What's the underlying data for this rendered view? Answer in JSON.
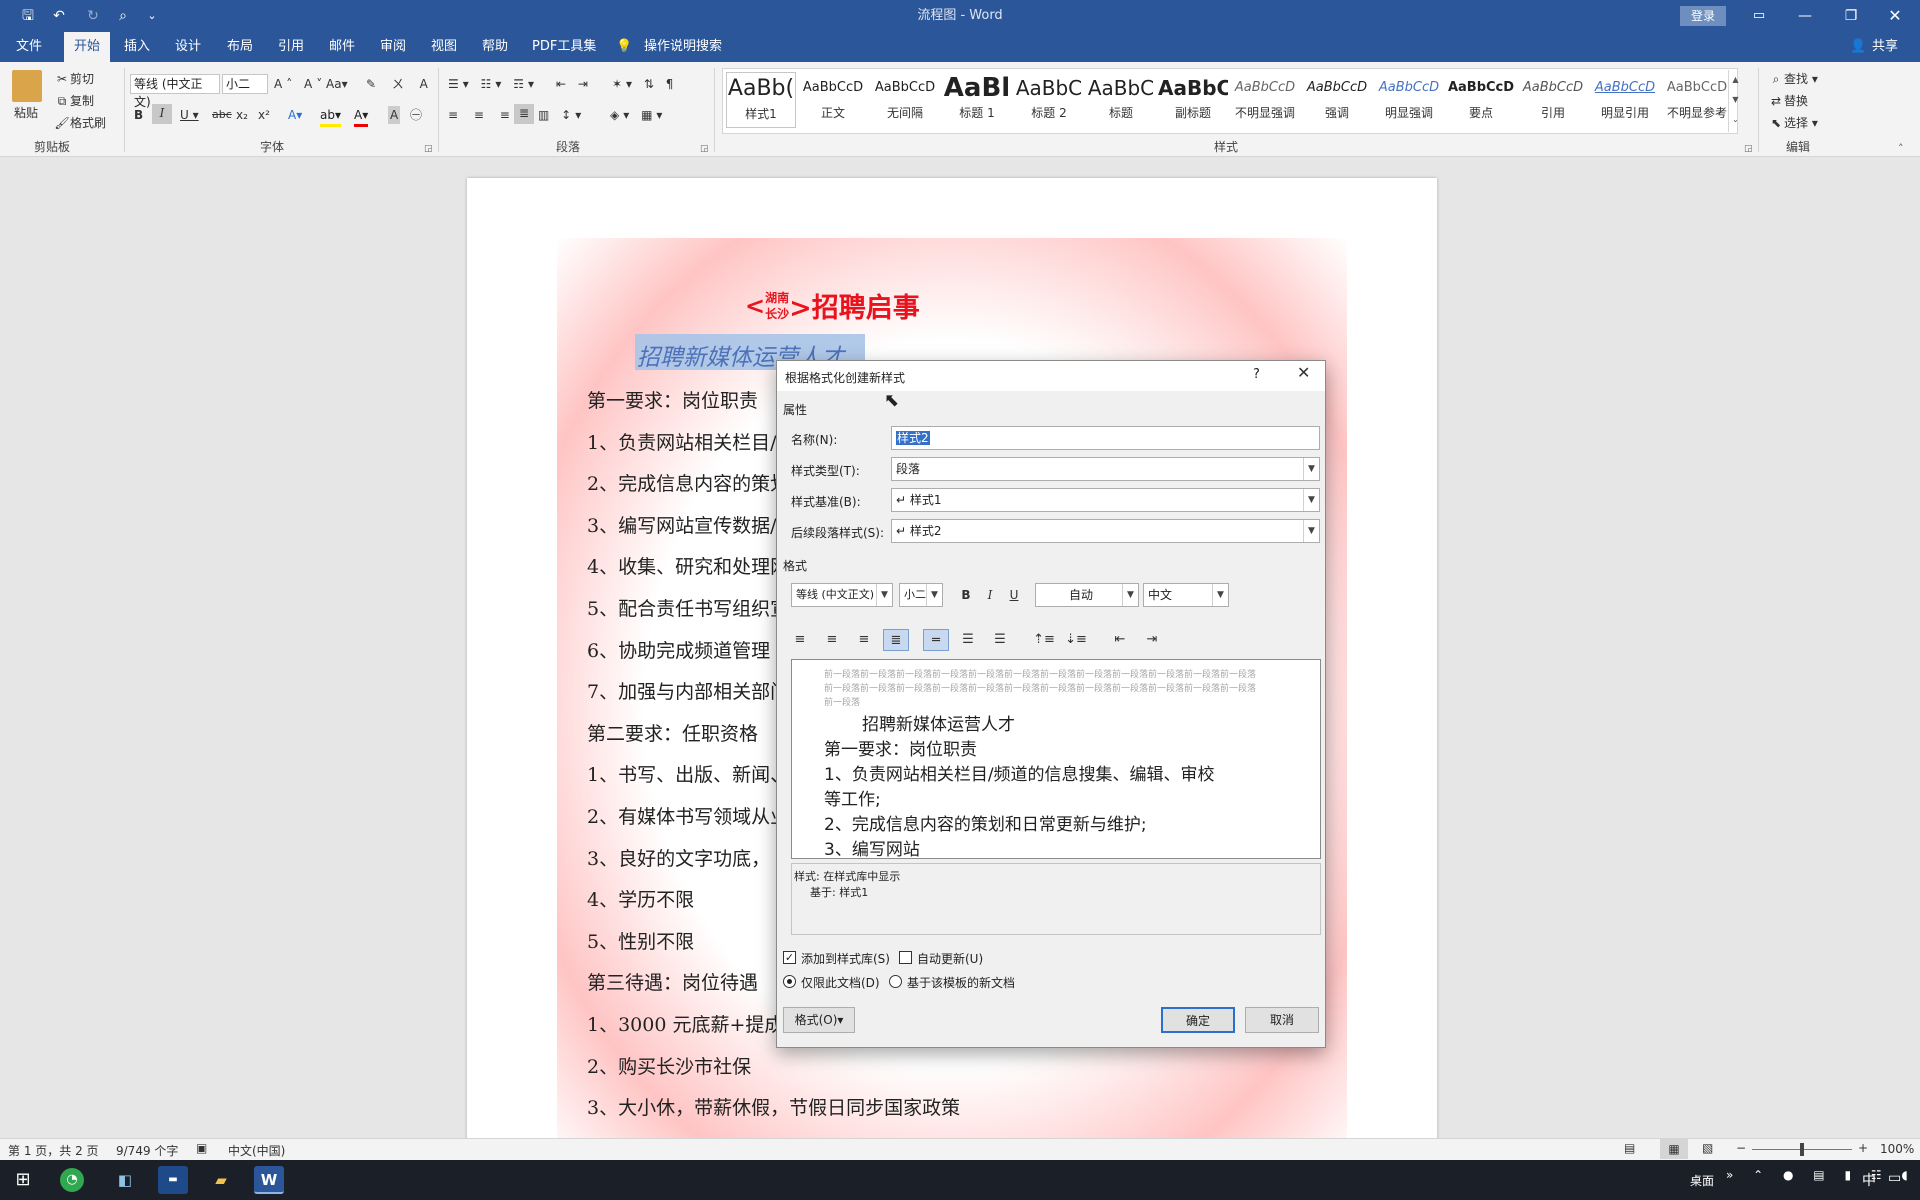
{
  "titlebar": {
    "title": "流程图 - Word",
    "login": "登录"
  },
  "tabs": [
    "文件",
    "开始",
    "插入",
    "设计",
    "布局",
    "引用",
    "邮件",
    "审阅",
    "视图",
    "帮助",
    "PDF工具集"
  ],
  "tell_me": "操作说明搜索",
  "share": "共享",
  "clipboard": {
    "paste": "粘贴",
    "cut": "剪切",
    "copy": "复制",
    "format_painter": "格式刷",
    "label": "剪贴板"
  },
  "font": {
    "name": "等线 (中文正文)",
    "size": "小二",
    "label": "字体"
  },
  "paragraph": {
    "label": "段落"
  },
  "styles": {
    "label": "样式",
    "items": [
      {
        "preview": "AaBb(",
        "name": "样式1"
      },
      {
        "preview": "AaBbCcD",
        "name": "正文"
      },
      {
        "preview": "AaBbCcD",
        "name": "无间隔"
      },
      {
        "preview": "AaBl",
        "name": "标题 1"
      },
      {
        "preview": "AaBbC",
        "name": "标题 2"
      },
      {
        "preview": "AaBbC",
        "name": "标题"
      },
      {
        "preview": "AaBbC",
        "name": "副标题"
      },
      {
        "preview": "AaBbCcD",
        "name": "不明显强调"
      },
      {
        "preview": "AaBbCcD",
        "name": "强调"
      },
      {
        "preview": "AaBbCcD",
        "name": "明显强调"
      },
      {
        "preview": "AaBbCcD",
        "name": "要点"
      },
      {
        "preview": "AaBbCcD",
        "name": "引用"
      },
      {
        "preview": "AaBbCcD",
        "name": "明显引用"
      },
      {
        "preview": "AaBbCcD",
        "name": "不明显参考"
      }
    ]
  },
  "editing": {
    "find": "查找",
    "replace": "替换",
    "select": "选择",
    "label": "编辑"
  },
  "document": {
    "heading_left": "<",
    "heading_top": "湖南",
    "heading_bottom": "长沙",
    "heading_right": ">招聘启事",
    "subtitle": "招聘新媒体运营人才",
    "lines": [
      "第一要求：岗位职责",
      "1、负责网站相关栏目/",
      "2、完成信息内容的策划",
      "3、编写网站宣传数据/",
      "4、收集、研究和处理网",
      "5、配合责任书写组织宣",
      "6、协助完成频道管理",
      "7、加强与内部相关部门",
      "第二要求：任职资格",
      "1、书写、出版、新闻、",
      "2、有媒体书写领域从业",
      "3、良好的文字功底，",
      "4、学历不限",
      "5、性别不限",
      "第三待遇：岗位待遇",
      "1、3000 元底薪+提成",
      "2、购买长沙市社保",
      "3、大小休，带薪休假，节假日同步国家政策"
    ]
  },
  "style_pane": {
    "title": "样式"
  },
  "dialog": {
    "title": "根据格式化创建新样式",
    "help": "?",
    "section_props": "属性",
    "name_label": "名称(N):",
    "name_value": "样式2",
    "type_label": "样式类型(T):",
    "type_value": "段落",
    "based_label": "样式基准(B):",
    "based_value": "↵ 样式1",
    "next_label": "后续段落样式(S):",
    "next_value": "↵ 样式2",
    "section_format": "格式",
    "font": "等线 (中文正文)",
    "size": "小二",
    "color": "自动",
    "lang": "中文",
    "preview_prev": "前一段落前一段落前一段落前一段落前一段落前一段落前一段落前一段落前一段落前一段落前一段落前一段落前一段落前一段落前一段落前一段落前一段落前一段落前一段落前一段落前一段落前一段落前一段落前一段落前一段落",
    "preview_lines": [
      "招聘新媒体运营人才",
      "第一要求：岗位职责",
      "1、负责网站相关栏目/频道的信息搜集、编辑、审校",
      "等工作;",
      "2、完成信息内容的策划和日常更新与维护;",
      "3、编写网站"
    ],
    "desc1": "样式: 在样式库中显示",
    "desc2": "基于: 样式1",
    "chk_add": "添加到样式库(S)",
    "chk_auto": "自动更新(U)",
    "radio_doc": "仅限此文档(D)",
    "radio_tpl": "基于该模板的新文档",
    "format_btn": "格式(O)▾",
    "ok": "确定",
    "cancel": "取消"
  },
  "status": {
    "page": "第 1 页，共 2 页",
    "words": "9/749 个字",
    "lang": "中文(中国)",
    "zoom": "100%"
  },
  "taskbar": {
    "desktop": "桌面",
    "ime": "中"
  }
}
